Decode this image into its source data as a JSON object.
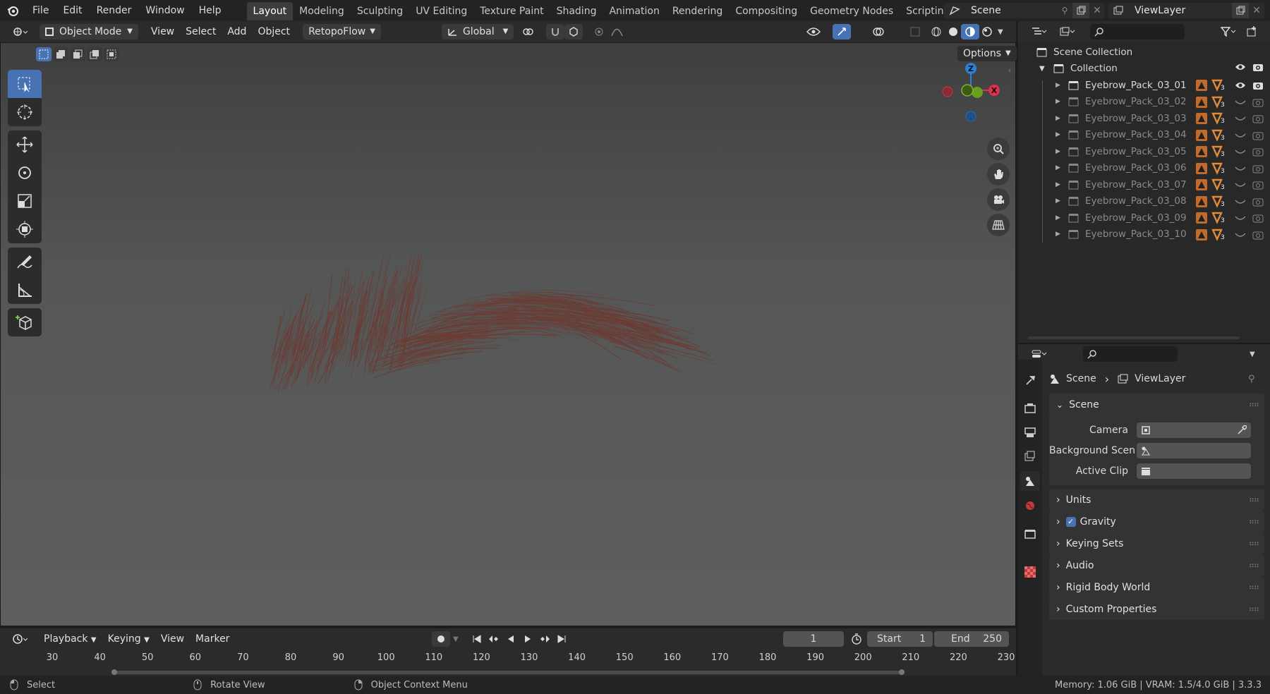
{
  "topbar": {
    "menus": [
      "File",
      "Edit",
      "Render",
      "Window",
      "Help"
    ],
    "workspaces": [
      "Layout",
      "Modeling",
      "Sculpting",
      "UV Editing",
      "Texture Paint",
      "Shading",
      "Animation",
      "Rendering",
      "Compositing",
      "Geometry Nodes",
      "Scripting"
    ],
    "active_workspace": "Layout",
    "add_tab": "+",
    "scene_name": "Scene",
    "view_layer_name": "ViewLayer"
  },
  "viewport_header": {
    "mode": "Object Mode",
    "menus": [
      "View",
      "Select",
      "Add",
      "Object"
    ],
    "addon_menu": "RetopoFlow",
    "transform_orientation": "Global",
    "options_label": "Options"
  },
  "gizmo": {
    "z_label": "Z",
    "x_label": "X"
  },
  "outliner": {
    "scene_collection": "Scene Collection",
    "collection": "Collection",
    "items": [
      {
        "name": "Eyebrow_Pack_03_01",
        "visible": true
      },
      {
        "name": "Eyebrow_Pack_03_02",
        "visible": false
      },
      {
        "name": "Eyebrow_Pack_03_03",
        "visible": false
      },
      {
        "name": "Eyebrow_Pack_03_04",
        "visible": false
      },
      {
        "name": "Eyebrow_Pack_03_05",
        "visible": false
      },
      {
        "name": "Eyebrow_Pack_03_06",
        "visible": false
      },
      {
        "name": "Eyebrow_Pack_03_07",
        "visible": false
      },
      {
        "name": "Eyebrow_Pack_03_08",
        "visible": false
      },
      {
        "name": "Eyebrow_Pack_03_09",
        "visible": false
      },
      {
        "name": "Eyebrow_Pack_03_10",
        "visible": false
      }
    ],
    "modifier_count": "3"
  },
  "properties": {
    "breadcrumb_scene": "Scene",
    "breadcrumb_viewlayer": "ViewLayer",
    "panel_scene": "Scene",
    "camera_label": "Camera",
    "background_scene_label": "Background Scen",
    "active_clip_label": "Active Clip",
    "panels": [
      "Units",
      "Gravity",
      "Keying Sets",
      "Audio",
      "Rigid Body World",
      "Custom Properties"
    ],
    "gravity_checked": true
  },
  "timeline": {
    "menus": [
      "Playback",
      "Keying",
      "View",
      "Marker"
    ],
    "current_frame": "1",
    "start_label": "Start",
    "start_value": "1",
    "end_label": "End",
    "end_value": "250",
    "ruler_ticks": [
      "30",
      "40",
      "50",
      "60",
      "70",
      "80",
      "90",
      "100",
      "110",
      "120",
      "130",
      "140",
      "150",
      "160",
      "170",
      "180",
      "190",
      "200",
      "210",
      "220",
      "230"
    ]
  },
  "statusbar": {
    "select": "Select",
    "rotate_view": "Rotate View",
    "context_menu": "Object Context Menu",
    "memory": "Memory: 1.06 GiB | VRAM: 1.5/4.0 GiB | 3.3.3"
  },
  "colors": {
    "accent": "#4772b3",
    "axis_x": "#e0304a",
    "axis_y": "#6a9e1f",
    "axis_z": "#2d7fd7",
    "eyebrow": "#6b3c34"
  }
}
